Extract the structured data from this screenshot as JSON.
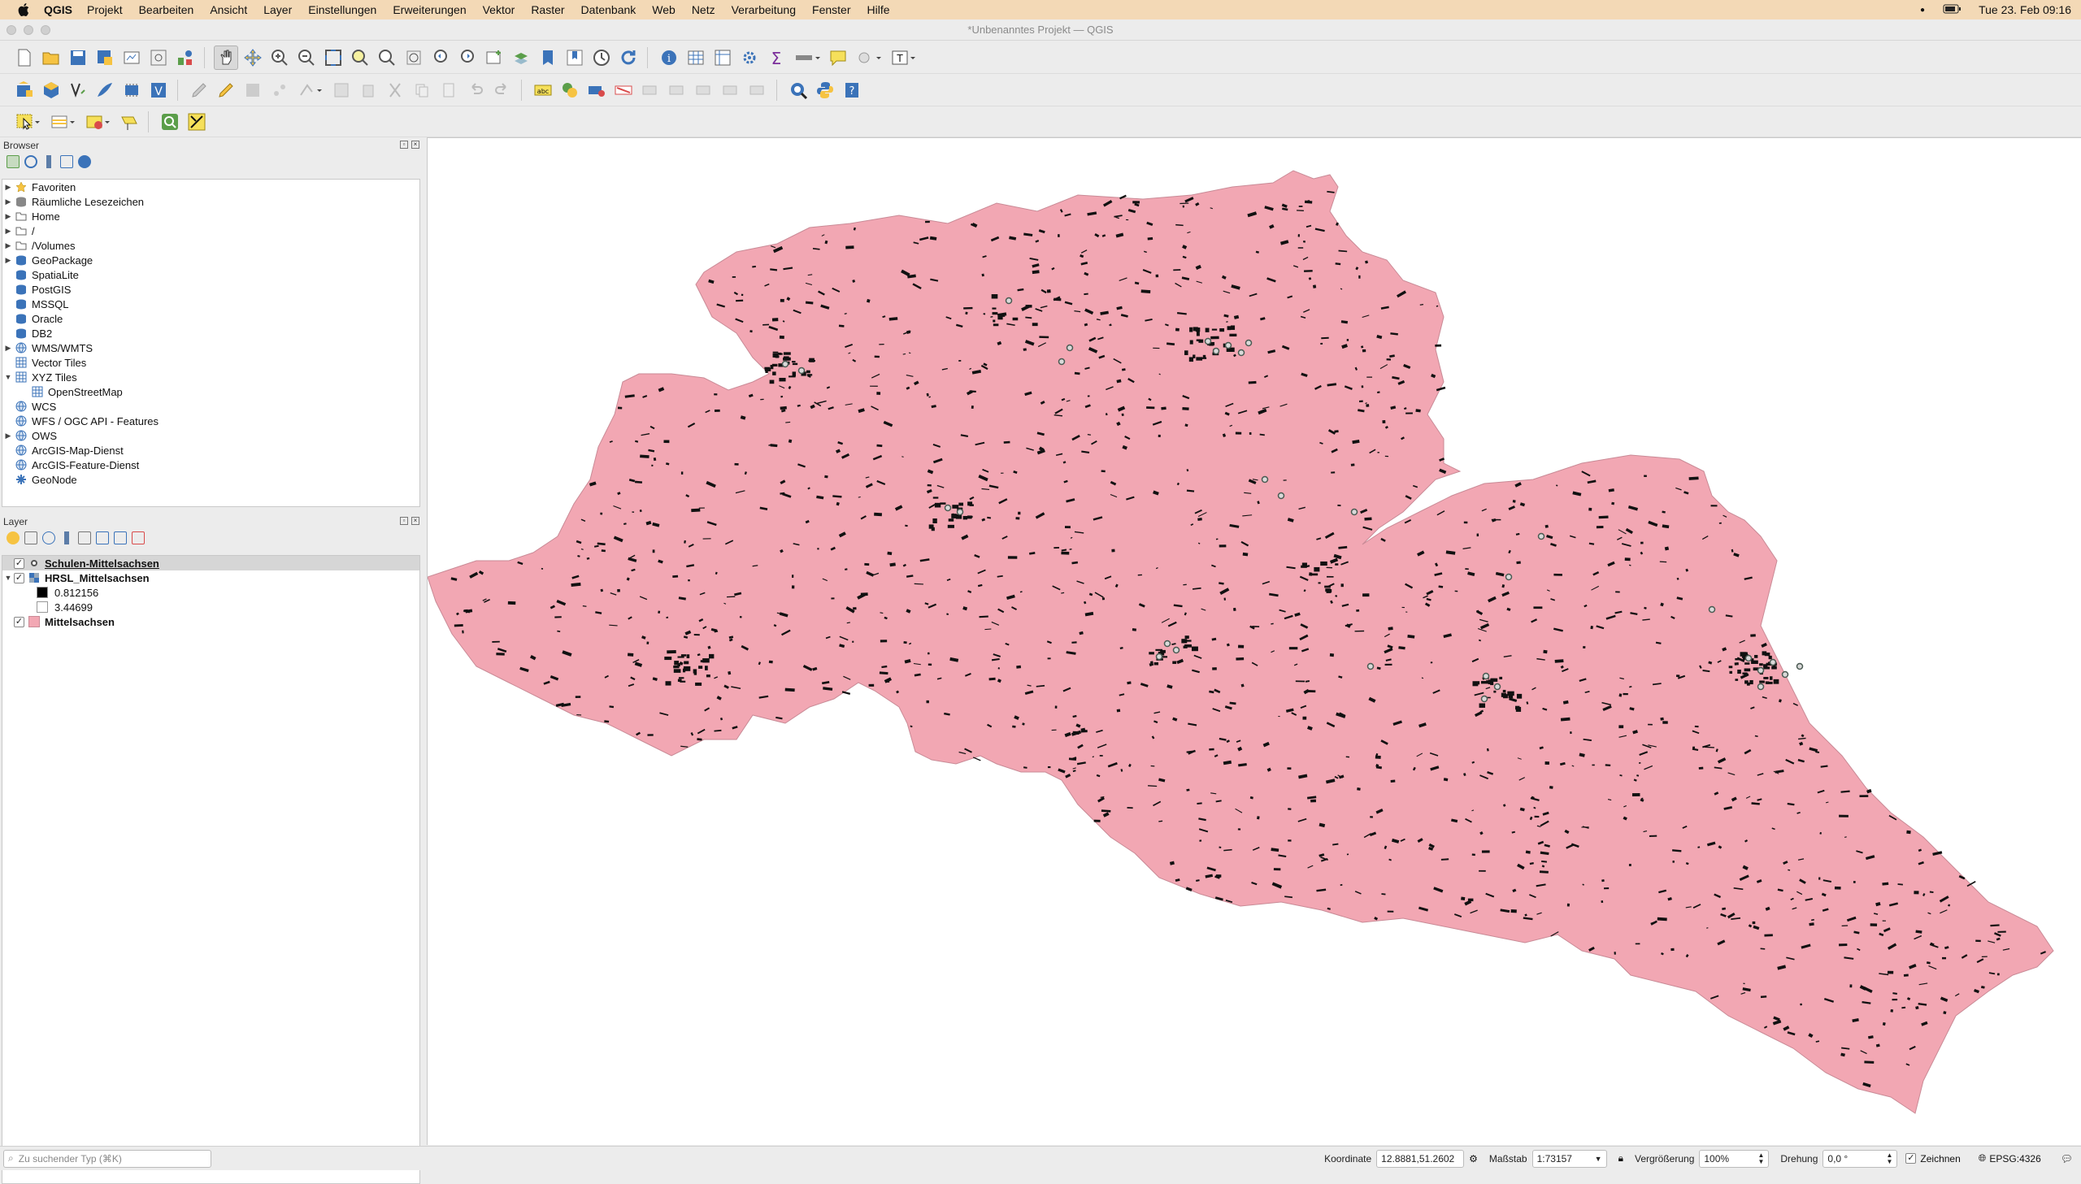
{
  "menubar": {
    "app": "QGIS",
    "items": [
      "Projekt",
      "Bearbeiten",
      "Ansicht",
      "Layer",
      "Einstellungen",
      "Erweiterungen",
      "Vektor",
      "Raster",
      "Datenbank",
      "Web",
      "Netz",
      "Verarbeitung",
      "Fenster",
      "Hilfe"
    ],
    "clock": "Tue 23. Feb  09:16"
  },
  "window": {
    "title": "*Unbenanntes Projekt — QGIS"
  },
  "browser": {
    "title": "Browser",
    "items": [
      {
        "label": "Favoriten",
        "icon": "star-icon",
        "expand": "collapsed"
      },
      {
        "label": "Räumliche Lesezeichen",
        "icon": "bookmark-icon",
        "expand": "collapsed"
      },
      {
        "label": "Home",
        "icon": "home-folder-icon",
        "expand": "collapsed"
      },
      {
        "label": "/",
        "icon": "folder-icon",
        "expand": "collapsed"
      },
      {
        "label": "/Volumes",
        "icon": "folder-icon",
        "expand": "collapsed"
      },
      {
        "label": "GeoPackage",
        "icon": "geopackage-icon",
        "expand": "collapsed"
      },
      {
        "label": "SpatiaLite",
        "icon": "spatialite-icon",
        "expand": "none"
      },
      {
        "label": "PostGIS",
        "icon": "postgis-icon",
        "expand": "none"
      },
      {
        "label": "MSSQL",
        "icon": "mssql-icon",
        "expand": "none"
      },
      {
        "label": "Oracle",
        "icon": "oracle-icon",
        "expand": "none"
      },
      {
        "label": "DB2",
        "icon": "db2-icon",
        "expand": "none"
      },
      {
        "label": "WMS/WMTS",
        "icon": "globe-icon",
        "expand": "collapsed"
      },
      {
        "label": "Vector Tiles",
        "icon": "grid-icon",
        "expand": "none"
      },
      {
        "label": "XYZ Tiles",
        "icon": "grid-icon",
        "expand": "expanded"
      },
      {
        "label": "OpenStreetMap",
        "icon": "grid-icon",
        "expand": "child"
      },
      {
        "label": "WCS",
        "icon": "globe-icon",
        "expand": "none"
      },
      {
        "label": "WFS / OGC API - Features",
        "icon": "globe-icon",
        "expand": "none"
      },
      {
        "label": "OWS",
        "icon": "globe-icon",
        "expand": "collapsed"
      },
      {
        "label": "ArcGIS-Map-Dienst",
        "icon": "globe-icon",
        "expand": "none"
      },
      {
        "label": "ArcGIS-Feature-Dienst",
        "icon": "globe-icon",
        "expand": "none"
      },
      {
        "label": "GeoNode",
        "icon": "geonode-icon",
        "expand": "none"
      }
    ]
  },
  "layers": {
    "title": "Layer",
    "items": [
      {
        "label": "Schulen-Mittelsachsen",
        "checked": true,
        "bold": true,
        "underline": true,
        "selected": true,
        "symbol": "point",
        "color": "#555555"
      },
      {
        "label": "HRSL_Mittelsachsen",
        "checked": true,
        "bold": true,
        "expand": "expanded",
        "symbol": "raster"
      },
      {
        "label": "0.812156",
        "legend": true,
        "color": "#000000"
      },
      {
        "label": "3.44699",
        "legend": true,
        "color": "#ffffff"
      },
      {
        "label": "Mittelsachsen",
        "checked": true,
        "bold": true,
        "symbol": "fill",
        "color": "#f2a7b3"
      }
    ]
  },
  "status": {
    "search_placeholder": "Zu suchender Typ (⌘K)",
    "coord_label": "Koordinate",
    "coord_value": "12.8881,51.2602",
    "scale_label": "Maßstab",
    "scale_value": "1:73157",
    "mag_label": "Vergrößerung",
    "mag_value": "100%",
    "rot_label": "Drehung",
    "rot_value": "0,0 °",
    "render_label": "Zeichnen",
    "crs": "EPSG:4326"
  },
  "map": {
    "district_fill": "#f2a7b3",
    "settlement_color": "#111111",
    "school_color": "#4a5a52"
  }
}
